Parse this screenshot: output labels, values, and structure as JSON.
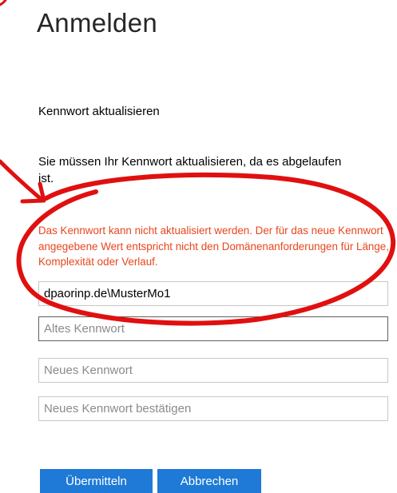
{
  "page": {
    "title": "Anmelden",
    "section_heading": "Kennwort aktualisieren",
    "info_text": "Sie müssen Ihr Kennwort aktualisieren, da es abgelaufen ist.",
    "error_text": "Das Kennwort kann nicht aktualisiert werden. Der für das neue Kennwort angegebene Wert entspricht nicht den Domänenanforderungen für Länge, Komplexität oder Verlauf."
  },
  "form": {
    "username_value": "dpaorinp.de\\MusterMo1",
    "old_password_placeholder": "Altes Kennwort",
    "new_password_placeholder": "Neues Kennwort",
    "confirm_password_placeholder": "Neues Kennwort bestätigen"
  },
  "buttons": {
    "submit_label": "Übermitteln",
    "cancel_label": "Abbrechen"
  },
  "colors": {
    "error": "#e8461c",
    "button": "#1e7ad6",
    "annotation": "#e01010"
  }
}
